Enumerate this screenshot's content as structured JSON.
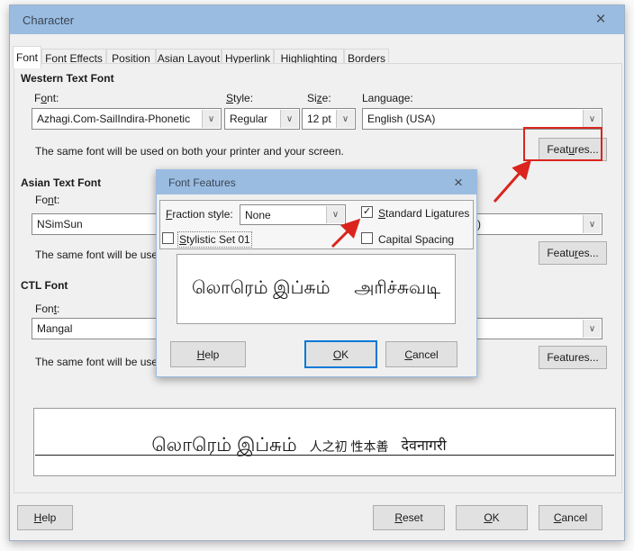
{
  "colors": {
    "titlebar": "#9bbce1",
    "annotation_red": "#d9251d",
    "default_button_border": "#0078d7",
    "dialog_bg": "#f0f0f0"
  },
  "icons": {
    "chevron": "∨",
    "close": "×",
    "check": "✓"
  },
  "window": {
    "title": "Character"
  },
  "tabs": [
    {
      "label": "Font"
    },
    {
      "label": "Font Effects"
    },
    {
      "label": "Position"
    },
    {
      "label": "Asian Layout"
    },
    {
      "label": "Hyperlink"
    },
    {
      "label": "Highlighting"
    },
    {
      "label": "Borders"
    }
  ],
  "western": {
    "section_title": "Western Text Font",
    "font_label": {
      "pre": "F",
      "key": "o",
      "post": "nt:"
    },
    "font_value": "Azhagi.Com-SailIndira-Phonetic",
    "style_label": {
      "pre": "",
      "key": "S",
      "post": "tyle:"
    },
    "style_value": "Regular",
    "size_label": {
      "pre": "Si",
      "key": "z",
      "post": "e:"
    },
    "size_value": "12 pt",
    "language_label": {
      "pre": "Lan",
      "key": "g",
      "post": "uage:"
    },
    "language_value": "English (USA)",
    "note": "The same font will be used on both your printer and your screen.",
    "features_button": {
      "pre": "Feat",
      "key": "u",
      "post": "res..."
    }
  },
  "asian": {
    "section_title": "Asian Text Font",
    "font_label": {
      "pre": "Fo",
      "key": "n",
      "post": "t:"
    },
    "font_value": "NSimSun",
    "language_fragment": ")",
    "note": "The same font will be used on both your printer and your screen.",
    "features_button": {
      "pre": "Featu",
      "key": "r",
      "post": "es..."
    }
  },
  "ctl": {
    "section_title": "CTL Font",
    "font_label": {
      "pre": "Fon",
      "key": "t",
      "post": ":"
    },
    "font_value": "Mangal",
    "note": "The same font will be used on both your printer and your screen.",
    "features_button": {
      "label": "Features..."
    }
  },
  "preview": {
    "tamil": "லொரெம் இப்சும்",
    "cjk": "人之初 性本善",
    "devanagari": "देवनागरी"
  },
  "footer": {
    "help": {
      "pre": "",
      "key": "H",
      "post": "elp"
    },
    "reset": {
      "pre": "",
      "key": "R",
      "post": "eset"
    },
    "ok": {
      "pre": "",
      "key": "O",
      "post": "K"
    },
    "cancel": {
      "pre": "",
      "key": "C",
      "post": "ancel"
    }
  },
  "font_features_dialog": {
    "title": "Font Features",
    "fraction_label": {
      "pre": "",
      "key": "F",
      "post": "raction style:"
    },
    "fraction_value": "None",
    "standard_ligatures": {
      "pre": "",
      "key": "S",
      "post": "tandard Ligatures",
      "checked": true
    },
    "stylistic_set": {
      "pre": "",
      "key": "S",
      "post": "tylistic Set 01",
      "checked": false
    },
    "capital_spacing": {
      "label": "Capital Spacing",
      "checked": false
    },
    "preview_tamil_1": "லொரெம் இப்சும்",
    "preview_tamil_2": "அரிச்சுவடி",
    "help": {
      "pre": "",
      "key": "H",
      "post": "elp"
    },
    "ok": {
      "pre": "",
      "key": "O",
      "post": "K"
    },
    "cancel": {
      "pre": "",
      "key": "C",
      "post": "ancel"
    }
  }
}
